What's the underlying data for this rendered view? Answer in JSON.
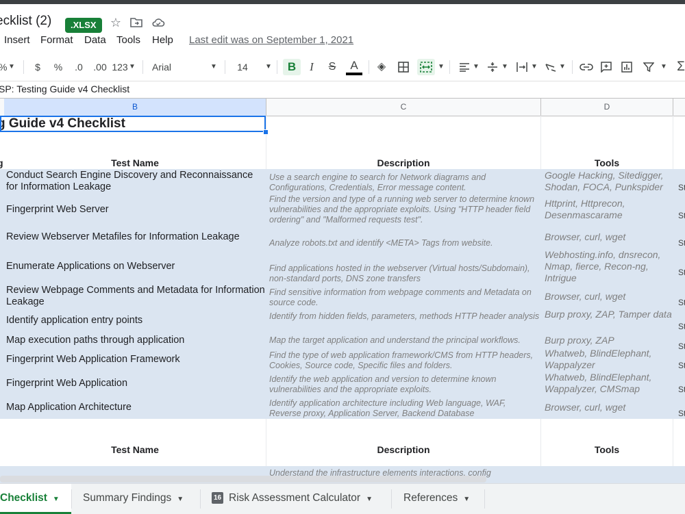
{
  "app": {
    "doc_title": "ecklist (2)",
    "badge": ".XLSX",
    "icons": [
      "star-icon",
      "move-to-folder-icon",
      "cloud-status-icon"
    ]
  },
  "menu": {
    "items": [
      "Insert",
      "Format",
      "Data",
      "Tools",
      "Help"
    ],
    "last_edit": "Last edit was on September 1, 2021"
  },
  "toolbar": {
    "percent": "%",
    "currency": "$",
    "percent_format": "%",
    "decrease_decimal": ".0",
    "increase_decimal": ".00",
    "more_formats": "123",
    "font": "Arial",
    "font_size": "14",
    "bold": "B",
    "italic": "I",
    "strike": "S",
    "text_color": "A"
  },
  "formula_bar": {
    "content": "SP: Testing Guide v4 Checklist"
  },
  "columns": [
    "B",
    "C",
    "D"
  ],
  "sheet": {
    "heading": "g Guide v4 Checklist",
    "headers": {
      "col_a": "g",
      "name": "Test Name",
      "desc": "Description",
      "tools": "Tools"
    },
    "rows": [
      {
        "name": "Conduct Search Engine Discovery and Reconnaissance for Information Leakage",
        "desc": "Use a search engine to search for Network diagrams and Configurations, Credentials, Error message content.",
        "tools": "Google Hacking, Sitedigger, Shodan, FOCA, Punkspider",
        "e": "St"
      },
      {
        "name": "Fingerprint Web Server",
        "desc": "Find the version and type of a running web server to determine known vulnerabilities and the appropriate exploits. Using \"HTTP header field ordering\" and \"Malformed requests test\".",
        "tools": "Httprint, Httprecon, Desenmascarame",
        "e": "St"
      },
      {
        "name": "Review Webserver Metafiles for Information Leakage",
        "desc": "Analyze robots.txt and identify <META> Tags from website.",
        "tools": "Browser, curl, wget",
        "e": "St"
      },
      {
        "name": "Enumerate Applications on Webserver",
        "desc": "Find applications hosted in the webserver (Virtual hosts/Subdomain), non-standard ports, DNS zone transfers",
        "tools": "Webhosting.info, dnsrecon, Nmap, fierce, Recon-ng, Intrigue",
        "e": "St"
      },
      {
        "name": "Review Webpage Comments and Metadata for Information Leakage",
        "desc": "Find sensitive information from webpage comments and Metadata on source code.",
        "tools": "Browser, curl, wget",
        "e": "St"
      },
      {
        "name": "Identify application entry points",
        "desc": "Identify from hidden fields, parameters, methods HTTP header analysis",
        "tools": "Burp proxy, ZAP, Tamper data",
        "e": "St"
      },
      {
        "name": "Map execution paths through application",
        "desc": "Map the target application and understand the principal workflows.",
        "tools": "Burp proxy, ZAP",
        "e": "St"
      },
      {
        "name": "Fingerprint Web Application Framework",
        "desc": "Find the type of web application framework/CMS from HTTP headers, Cookies, Source code, Specific files and folders.",
        "tools": "Whatweb, BlindElephant, Wappalyzer",
        "e": "St"
      },
      {
        "name": "Fingerprint Web Application",
        "desc": "Identify the web application and version to determine known vulnerabilities and the appropriate exploits.",
        "tools": "Whatweb, BlindElephant, Wappalyzer, CMSmap",
        "e": "St"
      },
      {
        "name": "Map Application Architecture",
        "desc": "Identify application architecture including Web language, WAF, Reverse proxy, Application Server, Backend Database",
        "tools": "Browser, curl, wget",
        "e": "St"
      }
    ],
    "headers2": {
      "name": "Test Name",
      "desc": "Description",
      "tools": "Tools"
    },
    "partial_row_desc": "Understand the infrastructure elements interactions, config"
  },
  "tabs": [
    {
      "label": "Checklist",
      "active": true
    },
    {
      "label": "Summary Findings",
      "active": false
    },
    {
      "label": "Risk Assessment Calculator",
      "active": false,
      "badge": "16"
    },
    {
      "label": "References",
      "active": false
    }
  ],
  "colors": {
    "accent": "#188038",
    "band": "#dbe5f1",
    "selection": "#1a73e8"
  }
}
